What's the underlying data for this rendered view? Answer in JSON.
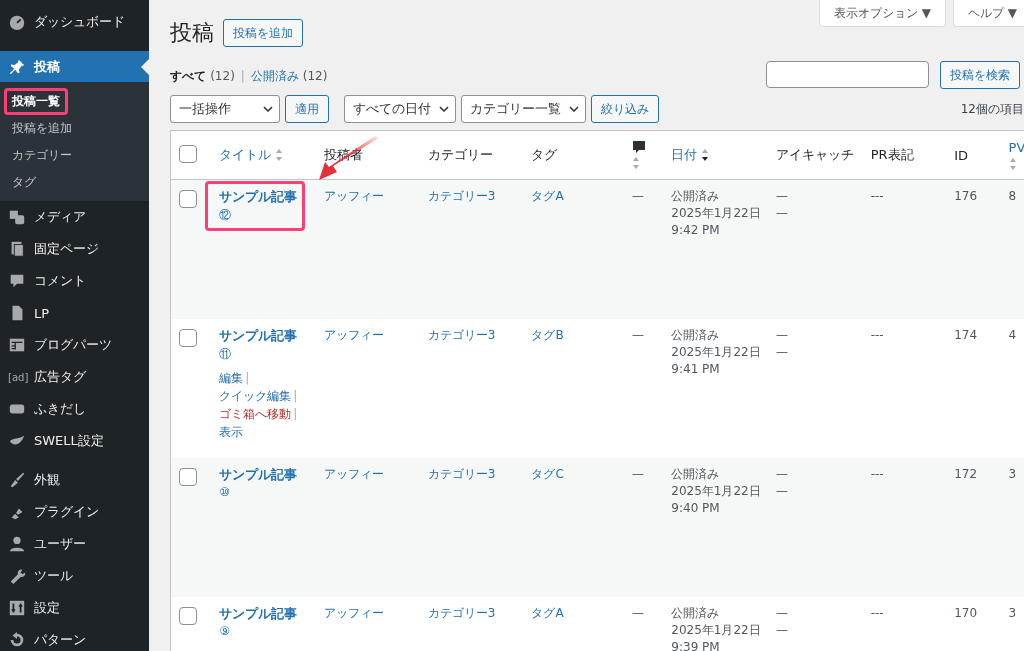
{
  "sidebar": {
    "items": [
      {
        "label": "ダッシュボード",
        "current": false
      },
      {
        "label": "投稿",
        "current": true,
        "submenu": [
          {
            "label": "投稿一覧",
            "selected": true,
            "highlighted": true
          },
          {
            "label": "投稿を追加",
            "selected": false,
            "highlighted": false
          },
          {
            "label": "カテゴリー",
            "selected": false,
            "highlighted": false
          },
          {
            "label": "タグ",
            "selected": false,
            "highlighted": false
          }
        ]
      },
      {
        "label": "メディア",
        "current": false
      },
      {
        "label": "固定ページ",
        "current": false
      },
      {
        "label": "コメント",
        "current": false
      },
      {
        "label": "LP",
        "current": false
      },
      {
        "label": "ブログパーツ",
        "current": false
      },
      {
        "label": "広告タグ",
        "current": false,
        "icon_text": "[ad]"
      },
      {
        "label": "ふきだし",
        "current": false
      },
      {
        "label": "SWELL設定",
        "current": false
      },
      {
        "label": "外観",
        "current": false,
        "separator_before": true
      },
      {
        "label": "プラグイン",
        "current": false
      },
      {
        "label": "ユーザー",
        "current": false
      },
      {
        "label": "ツール",
        "current": false
      },
      {
        "label": "設定",
        "current": false
      },
      {
        "label": "パターン",
        "current": false
      }
    ]
  },
  "screen_meta": [
    "表示オプション ▼",
    "ヘルプ ▼"
  ],
  "page_title": "投稿",
  "add_new": "投稿を追加",
  "views": [
    {
      "label": "すべて",
      "count": "(12)",
      "selected": true
    },
    {
      "separator": "|",
      "label": "公開済み",
      "count": "(12)",
      "selected": false
    }
  ],
  "search": {
    "button": "投稿を検索"
  },
  "tablenav": {
    "bulk": "一括操作",
    "apply": "適用",
    "dates": "すべての日付",
    "categories": "カテゴリー一覧",
    "filter": "絞り込み",
    "count": "12個の項目"
  },
  "table": {
    "columns": [
      {
        "kind": "checkbox",
        "checked": false
      },
      {
        "kind": "text",
        "label": "タイトル",
        "sortable": true,
        "sorted": false
      },
      {
        "kind": "text",
        "label": "投稿者",
        "sortable": false
      },
      {
        "kind": "text",
        "label": "カテゴリー",
        "sortable": false
      },
      {
        "kind": "text",
        "label": "タグ",
        "sortable": false
      },
      {
        "kind": "comment-icon",
        "sortable": true,
        "sorted": false
      },
      {
        "kind": "text",
        "label": "日付",
        "sortable": true,
        "sorted": true
      },
      {
        "kind": "text",
        "label": "アイキャッチ",
        "sortable": false
      },
      {
        "kind": "text",
        "label": "PR表記",
        "sortable": false
      },
      {
        "kind": "text",
        "label": "ID",
        "sortable": false
      },
      {
        "kind": "text",
        "label": "PV",
        "sortable": true,
        "sorted": false
      }
    ],
    "rows": [
      {
        "checked": false,
        "title": "サンプル記事",
        "number": "⑫",
        "highlighted": true,
        "author": "アッフィー",
        "category": "カテゴリー3",
        "tag": "タグA",
        "comments": "—",
        "status": "公開済み",
        "date": "2025年1月22日",
        "time": "9:42 PM",
        "eyecatch": [
          "—",
          "—"
        ],
        "pr": "---",
        "id": "176",
        "pv": "8"
      },
      {
        "checked": false,
        "title": "サンプル記事",
        "number": "⑪",
        "highlighted": false,
        "author": "アッフィー",
        "category": "カテゴリー3",
        "tag": "タグB",
        "comments": "—",
        "status": "公開済み",
        "date": "2025年1月22日",
        "time": "9:41 PM",
        "eyecatch": [
          "—",
          "—"
        ],
        "pr": "---",
        "id": "174",
        "pv": "4",
        "actions": [
          {
            "label": "編集",
            "kind": "link",
            "separator": "|"
          },
          {
            "label": "クイック編集",
            "kind": "link",
            "separator": "|"
          },
          {
            "label": "ゴミ箱へ移動",
            "kind": "delete",
            "separator": "|"
          },
          {
            "label": "表示",
            "kind": "link"
          }
        ]
      },
      {
        "checked": false,
        "title": "サンプル記事",
        "number": "⑩",
        "highlighted": false,
        "author": "アッフィー",
        "category": "カテゴリー3",
        "tag": "タグC",
        "comments": "—",
        "status": "公開済み",
        "date": "2025年1月22日",
        "time": "9:40 PM",
        "eyecatch": [
          "—",
          "—"
        ],
        "pr": "---",
        "id": "172",
        "pv": "3"
      },
      {
        "checked": false,
        "title": "サンプル記事",
        "number": "⑨",
        "highlighted": false,
        "author": "アッフィー",
        "category": "カテゴリー3",
        "tag": "タグA",
        "comments": "—",
        "status": "公開済み",
        "date": "2025年1月22日",
        "time": "9:39 PM",
        "eyecatch": [
          "—",
          "—"
        ],
        "pr": "---",
        "id": "170",
        "pv": "3"
      }
    ]
  },
  "annotation_arrow": true
}
